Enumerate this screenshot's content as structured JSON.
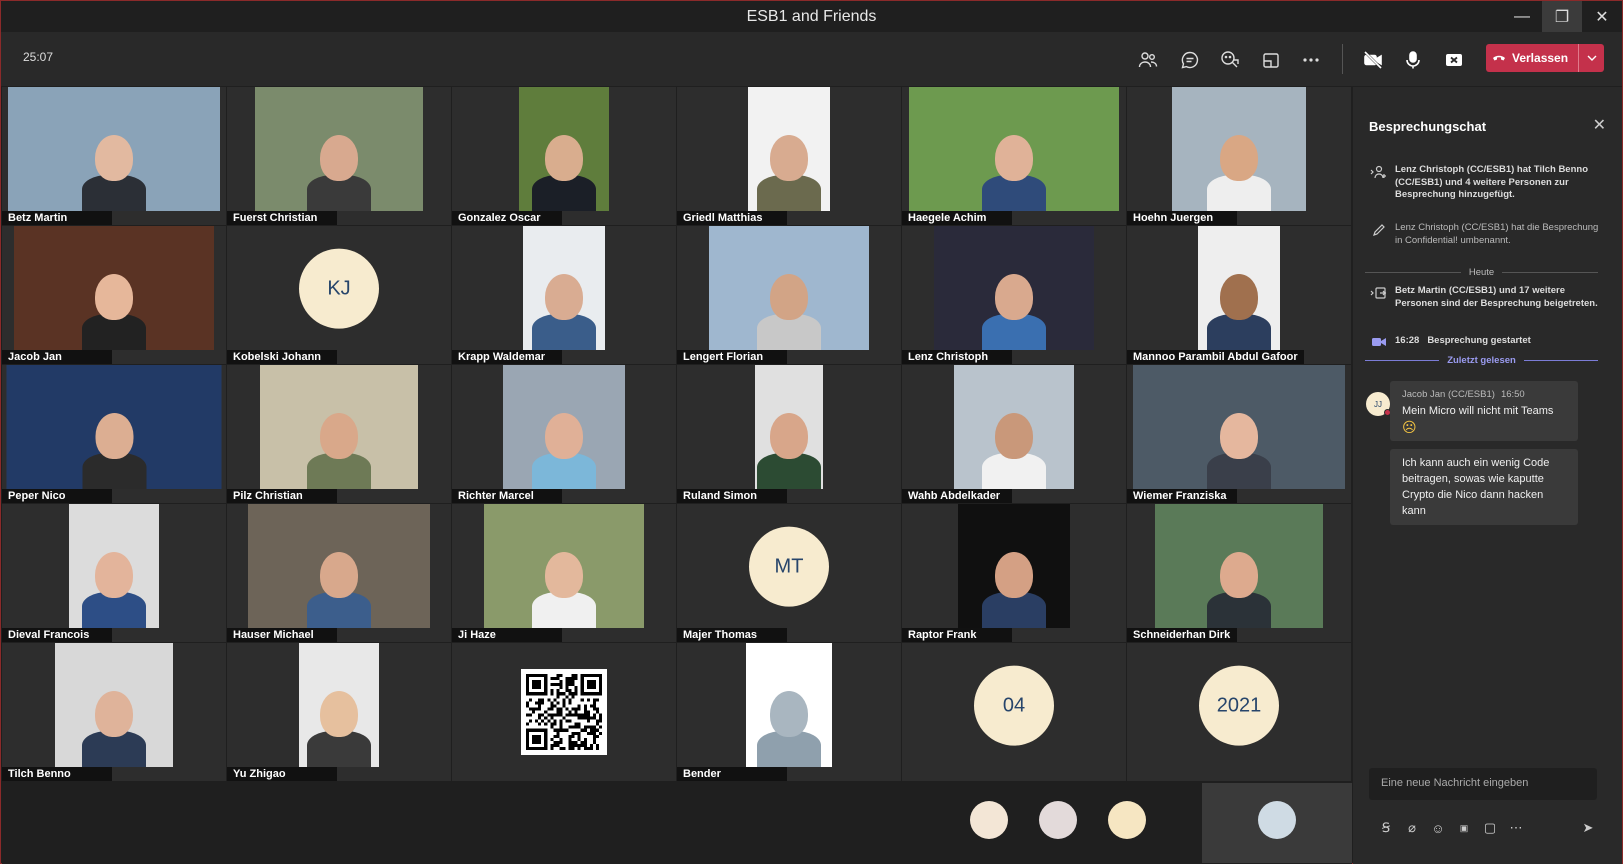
{
  "window": {
    "title": "ESB1 and Friends"
  },
  "toolbar": {
    "timer": "25:07",
    "leave_label": "Verlassen"
  },
  "grid": {
    "tiles": [
      {
        "name": "Betz Martin",
        "kind": "photo",
        "bg": "#8aa3b8",
        "skin": "#e2b9a0",
        "shirt": "#2b2f36",
        "w": 212
      },
      {
        "name": "Fuerst Christian",
        "kind": "photo",
        "bg": "#7b8b6c",
        "skin": "#d8a98f",
        "shirt": "#3a3a3a",
        "w": 168
      },
      {
        "name": "Gonzalez Oscar",
        "kind": "photo",
        "bg": "#5f7d3c",
        "skin": "#d9ad8e",
        "shirt": "#1b1f27",
        "w": 90
      },
      {
        "name": "Griedl Matthias",
        "kind": "photo",
        "bg": "#f2f2f2",
        "skin": "#d8ab90",
        "shirt": "#6b6a4e",
        "w": 82
      },
      {
        "name": "Haegele Achim",
        "kind": "photo",
        "bg": "#6d9a4f",
        "skin": "#e0b298",
        "shirt": "#2f4b7a",
        "w": 210
      },
      {
        "name": "Hoehn Juergen",
        "kind": "photo",
        "bg": "#a6b4bf",
        "skin": "#d9a784",
        "shirt": "#eeeeee",
        "w": 134
      },
      {
        "name": "Jacob Jan",
        "kind": "photo",
        "bg": "#5a3324",
        "skin": "#e6b79a",
        "shirt": "#222222",
        "w": 200
      },
      {
        "name": "Kobelski Johann",
        "kind": "initials",
        "initials": "KJ"
      },
      {
        "name": "Krapp Waldemar",
        "kind": "photo",
        "bg": "#e9ecef",
        "skin": "#d9ac92",
        "shirt": "#3a5d8a",
        "w": 82
      },
      {
        "name": "Lengert Florian",
        "kind": "photo",
        "bg": "#9fb7cf",
        "skin": "#d2a486",
        "shirt": "#c8c8c8",
        "w": 160
      },
      {
        "name": "Lenz Christoph",
        "kind": "photo",
        "bg": "#2a2a3a",
        "skin": "#d9a98e",
        "shirt": "#3a6fb0",
        "w": 160
      },
      {
        "name": "Mannoo Parambil Abdul Gafoor",
        "kind": "photo",
        "bg": "#eeeeee",
        "skin": "#a0704e",
        "shirt": "#2c3e5e",
        "w": 82
      },
      {
        "name": "Peper Nico",
        "kind": "photo",
        "bg": "#223a66",
        "skin": "#dcae92",
        "shirt": "#2b2b2b",
        "w": 215
      },
      {
        "name": "Pilz Christian",
        "kind": "photo",
        "bg": "#c8c0a8",
        "skin": "#d9a88a",
        "shirt": "#6e7a56",
        "w": 158
      },
      {
        "name": "Richter Marcel",
        "kind": "photo",
        "bg": "#9aa6b3",
        "skin": "#e0b097",
        "shirt": "#7cb7d9",
        "w": 122
      },
      {
        "name": "Ruland Simon",
        "kind": "photo",
        "bg": "#e0e0e0",
        "skin": "#d8a68a",
        "shirt": "#2c4b33",
        "w": 68
      },
      {
        "name": "Wahb Abdelkader",
        "kind": "photo",
        "bg": "#b9c3cc",
        "skin": "#c9987a",
        "shirt": "#f1f1f1",
        "w": 120
      },
      {
        "name": "Wiemer Franziska",
        "kind": "photo",
        "bg": "#4d5a66",
        "skin": "#e5b79e",
        "shirt": "#3a3f4a",
        "w": 212
      },
      {
        "name": "Dieval Francois",
        "kind": "photo",
        "bg": "#dcdcdc",
        "skin": "#e3b49b",
        "shirt": "#2d4e86",
        "w": 90
      },
      {
        "name": "Hauser Michael",
        "kind": "photo",
        "bg": "#6d6458",
        "skin": "#d8a88c",
        "shirt": "#3c5e8c",
        "w": 182
      },
      {
        "name": "Ji Haze",
        "kind": "photo",
        "bg": "#8a9a6a",
        "skin": "#e3b89c",
        "shirt": "#f0f0f0",
        "w": 160
      },
      {
        "name": "Majer Thomas",
        "kind": "initials",
        "initials": "MT"
      },
      {
        "name": "Raptor Frank",
        "kind": "photo",
        "bg": "#101010",
        "skin": "#d4a084",
        "shirt": "#2a3e63",
        "w": 112
      },
      {
        "name": "Schneiderhan Dirk",
        "kind": "photo",
        "bg": "#5a7a58",
        "skin": "#ddaa8e",
        "shirt": "#2b3238",
        "w": 168
      },
      {
        "name": "Tilch Benno",
        "kind": "photo",
        "bg": "#d8d8d8",
        "skin": "#dfb39a",
        "shirt": "#2c3b55",
        "w": 118
      },
      {
        "name": "Yu Zhigao",
        "kind": "photo",
        "bg": "#e8e8e8",
        "skin": "#e6c09e",
        "shirt": "#3a3a3a",
        "w": 80
      },
      {
        "name": "",
        "kind": "qr"
      },
      {
        "name": "Bender",
        "kind": "photo",
        "bg": "#ffffff",
        "skin": "#a9b6c0",
        "shirt": "#8fa0ad",
        "w": 86
      },
      {
        "name": "",
        "kind": "initials",
        "initials": "04"
      },
      {
        "name": "",
        "kind": "initials",
        "initials": "2021"
      }
    ]
  },
  "strip": {
    "dot_colors": [
      "#f3e6d6",
      "#e3dada",
      "#f6e6c2",
      "#cfdbe4"
    ]
  },
  "chat": {
    "title": "Besprechungschat",
    "events": [
      {
        "text": "Lenz Christoph (CC/ESB1) hat Tilch Benno (CC/ESB1) und 4 weitere Personen zur Besprechung hinzugefügt.",
        "icon": "add-people-icon"
      },
      {
        "text": "Lenz Christoph (CC/ESB1) hat die Besprechung in Confidential! umbenannt.",
        "icon": "pencil-icon"
      },
      {
        "text": "Betz Martin (CC/ESB1) und 17 weitere Personen sind der Besprechung beigetreten.",
        "icon": "join-icon"
      },
      {
        "time": "16:28",
        "text": "Besprechung gestartet",
        "icon": "video-icon"
      }
    ],
    "day_divider": "Heute",
    "read_divider": "Zuletzt gelesen",
    "message": {
      "avatar_initials": "JJ",
      "author": "Jacob Jan (CC/ESB1)",
      "time": "16:50",
      "line1": "Mein Micro will nicht mit Teams",
      "emoji": "☹",
      "line2": "Ich kann auch ein wenig Code beitragen, sowas wie kaputte Crypto die Nico dann hacken kann"
    },
    "compose_placeholder": "Eine neue Nachricht eingeben"
  }
}
